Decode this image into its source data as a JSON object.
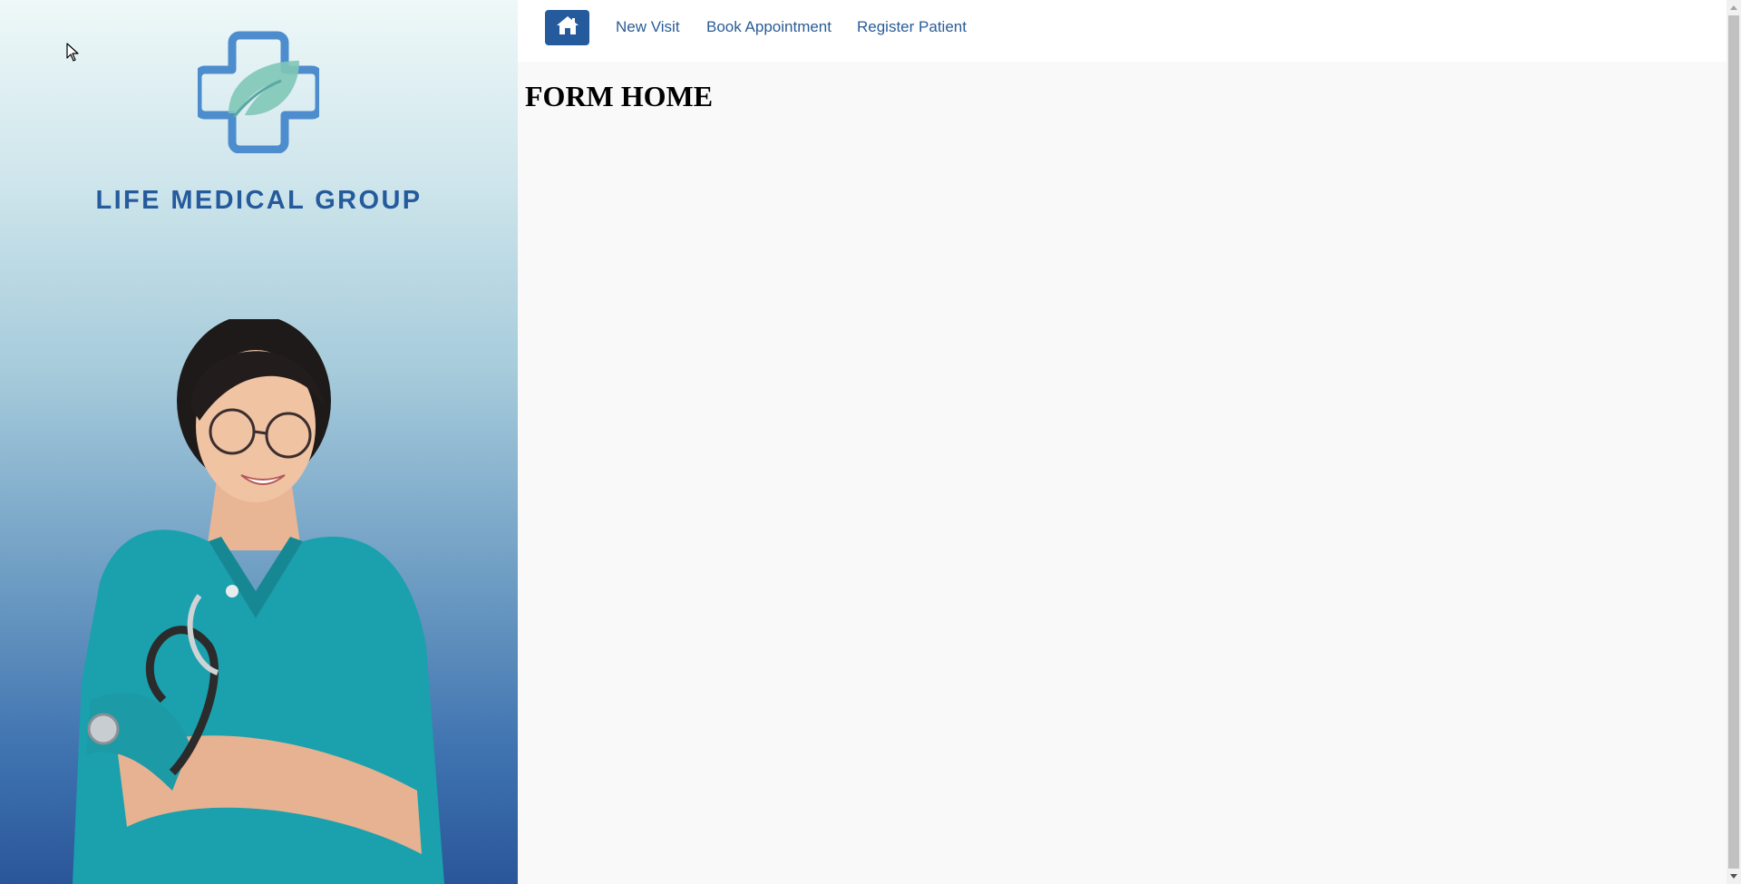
{
  "sidebar": {
    "brand_name": "LIFE MEDICAL GROUP",
    "logo_icon": "medical-cross-leaf-icon",
    "hero_image": "nurse-with-stethoscope",
    "brand_color": "#255b9c"
  },
  "topnav": {
    "home_icon": "home-icon",
    "links": [
      {
        "label": "New Visit"
      },
      {
        "label": "Book Appointment"
      },
      {
        "label": "Register Patient"
      }
    ],
    "accent_color": "#255b9c",
    "link_color": "#2a5c96"
  },
  "main": {
    "title": "FORM HOME"
  }
}
